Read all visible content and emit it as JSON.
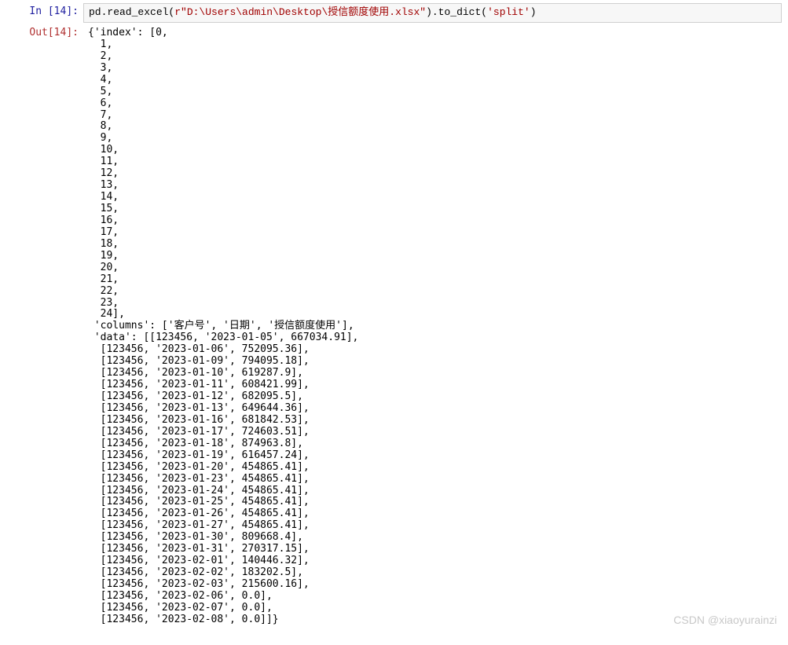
{
  "in_prompt": "In  [14]:",
  "out_prompt": "Out[14]:",
  "watermark": "CSDN @xiaoyurainzi",
  "code": {
    "prefix": "pd.read_excel(",
    "raw_prefix": "r",
    "path_literal": "\"D:\\Users\\admin\\Desktop\\授信额度使用.xlsx\"",
    "mid": ").to_dict(",
    "arg": "'split'",
    "suffix": ")"
  },
  "chart_data": {
    "type": "table",
    "index": [
      0,
      1,
      2,
      3,
      4,
      5,
      6,
      7,
      8,
      9,
      10,
      11,
      12,
      13,
      14,
      15,
      16,
      17,
      18,
      19,
      20,
      21,
      22,
      23,
      24
    ],
    "columns": [
      "客户号",
      "日期",
      "授信额度使用"
    ],
    "data": [
      [
        123456,
        "2023-01-05",
        667034.91
      ],
      [
        123456,
        "2023-01-06",
        752095.36
      ],
      [
        123456,
        "2023-01-09",
        794095.18
      ],
      [
        123456,
        "2023-01-10",
        619287.9
      ],
      [
        123456,
        "2023-01-11",
        608421.99
      ],
      [
        123456,
        "2023-01-12",
        682095.5
      ],
      [
        123456,
        "2023-01-13",
        649644.36
      ],
      [
        123456,
        "2023-01-16",
        681842.53
      ],
      [
        123456,
        "2023-01-17",
        724603.51
      ],
      [
        123456,
        "2023-01-18",
        874963.8
      ],
      [
        123456,
        "2023-01-19",
        616457.24
      ],
      [
        123456,
        "2023-01-20",
        454865.41
      ],
      [
        123456,
        "2023-01-23",
        454865.41
      ],
      [
        123456,
        "2023-01-24",
        454865.41
      ],
      [
        123456,
        "2023-01-25",
        454865.41
      ],
      [
        123456,
        "2023-01-26",
        454865.41
      ],
      [
        123456,
        "2023-01-27",
        454865.41
      ],
      [
        123456,
        "2023-01-30",
        809668.4
      ],
      [
        123456,
        "2023-01-31",
        270317.15
      ],
      [
        123456,
        "2023-02-01",
        140446.32
      ],
      [
        123456,
        "2023-02-02",
        183202.5
      ],
      [
        123456,
        "2023-02-03",
        215600.16
      ],
      [
        123456,
        "2023-02-06",
        0.0
      ],
      [
        123456,
        "2023-02-07",
        0.0
      ],
      [
        123456,
        "2023-02-08",
        0.0
      ]
    ]
  }
}
